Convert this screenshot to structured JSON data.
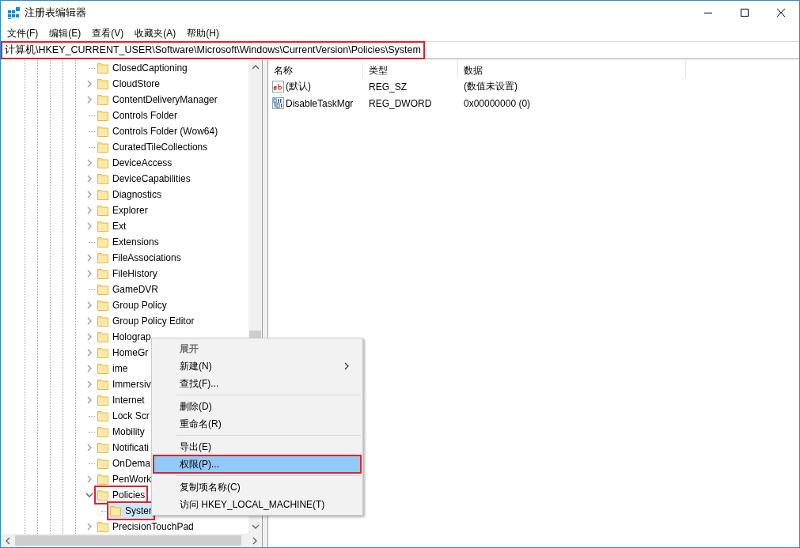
{
  "window": {
    "title": "注册表编辑器"
  },
  "menu": [
    "文件(F)",
    "编辑(E)",
    "查看(V)",
    "收藏夹(A)",
    "帮助(H)"
  ],
  "address_bar": {
    "value": "计算机\\HKEY_CURRENT_USER\\Software\\Microsoft\\Windows\\CurrentVersion\\Policies\\System",
    "highlighted": true
  },
  "tree": [
    {
      "label": "ClosedCaptioning",
      "kind": "leaf",
      "selected": false,
      "highlighted": false
    },
    {
      "label": "CloudStore",
      "kind": "node",
      "expanded": false,
      "selected": false,
      "highlighted": false
    },
    {
      "label": "ContentDeliveryManager",
      "kind": "node",
      "expanded": false,
      "selected": false,
      "highlighted": false
    },
    {
      "label": "Controls Folder",
      "kind": "leaf",
      "selected": false,
      "highlighted": false
    },
    {
      "label": "Controls Folder (Wow64)",
      "kind": "leaf",
      "selected": false,
      "highlighted": false
    },
    {
      "label": "CuratedTileCollections",
      "kind": "leaf",
      "selected": false,
      "highlighted": false
    },
    {
      "label": "DeviceAccess",
      "kind": "node",
      "expanded": false,
      "selected": false,
      "highlighted": false
    },
    {
      "label": "DeviceCapabilities",
      "kind": "node",
      "expanded": false,
      "selected": false,
      "highlighted": false
    },
    {
      "label": "Diagnostics",
      "kind": "node",
      "expanded": false,
      "selected": false,
      "highlighted": false
    },
    {
      "label": "Explorer",
      "kind": "node",
      "expanded": false,
      "selected": false,
      "highlighted": false
    },
    {
      "label": "Ext",
      "kind": "node",
      "expanded": false,
      "selected": false,
      "highlighted": false
    },
    {
      "label": "Extensions",
      "kind": "leaf",
      "selected": false,
      "highlighted": false
    },
    {
      "label": "FileAssociations",
      "kind": "node",
      "expanded": false,
      "selected": false,
      "highlighted": false
    },
    {
      "label": "FileHistory",
      "kind": "node",
      "expanded": false,
      "selected": false,
      "highlighted": false
    },
    {
      "label": "GameDVR",
      "kind": "leaf",
      "selected": false,
      "highlighted": false
    },
    {
      "label": "Group Policy",
      "kind": "node",
      "expanded": false,
      "selected": false,
      "highlighted": false
    },
    {
      "label": "Group Policy Editor",
      "kind": "node",
      "expanded": false,
      "selected": false,
      "highlighted": false
    },
    {
      "label": "Holograp",
      "kind": "node",
      "expanded": false,
      "selected": false,
      "highlighted": false
    },
    {
      "label": "HomeGr",
      "kind": "node",
      "expanded": false,
      "selected": false,
      "highlighted": false
    },
    {
      "label": "ime",
      "kind": "node",
      "expanded": false,
      "selected": false,
      "highlighted": false
    },
    {
      "label": "Immersiv",
      "kind": "node",
      "expanded": false,
      "selected": false,
      "highlighted": false
    },
    {
      "label": "Internet",
      "kind": "node",
      "expanded": false,
      "selected": false,
      "highlighted": false
    },
    {
      "label": "Lock Scr",
      "kind": "leaf",
      "selected": false,
      "highlighted": false
    },
    {
      "label": "Mobility",
      "kind": "leaf",
      "selected": false,
      "highlighted": false
    },
    {
      "label": "Notificati",
      "kind": "node",
      "expanded": false,
      "selected": false,
      "highlighted": false
    },
    {
      "label": "OnDema",
      "kind": "leaf",
      "selected": false,
      "highlighted": false
    },
    {
      "label": "PenWork",
      "kind": "node",
      "expanded": false,
      "selected": false,
      "highlighted": false
    },
    {
      "label": "Policies",
      "kind": "node",
      "expanded": true,
      "selected": false,
      "highlighted": true,
      "children": [
        {
          "label": "Syster",
          "kind": "leaf",
          "selected": true,
          "highlighted": true
        }
      ]
    },
    {
      "label": "PrecisionTouchPad",
      "kind": "node",
      "expanded": false,
      "selected": false,
      "highlighted": false
    }
  ],
  "list": {
    "columns": [
      "名称",
      "类型",
      "数据"
    ],
    "rows": [
      {
        "kind": "string",
        "name": "(默认)",
        "type": "REG_SZ",
        "data": "(数值未设置)"
      },
      {
        "kind": "binary",
        "name": "DisableTaskMgr",
        "type": "REG_DWORD",
        "data": "0x00000000 (0)"
      }
    ]
  },
  "context_menu": {
    "groups": [
      [
        {
          "label": "展开",
          "bold": true,
          "disabled": true,
          "submenu": false,
          "selected": false,
          "highlighted": false
        },
        {
          "label": "新建(N)",
          "bold": false,
          "disabled": false,
          "submenu": true,
          "selected": false,
          "highlighted": false
        },
        {
          "label": "查找(F)...",
          "bold": false,
          "disabled": false,
          "submenu": false,
          "selected": false,
          "highlighted": false
        }
      ],
      [
        {
          "label": "删除(D)",
          "bold": false,
          "disabled": false,
          "submenu": false,
          "selected": false,
          "highlighted": false
        },
        {
          "label": "重命名(R)",
          "bold": false,
          "disabled": false,
          "submenu": false,
          "selected": false,
          "highlighted": false
        }
      ],
      [
        {
          "label": "导出(E)",
          "bold": false,
          "disabled": false,
          "submenu": false,
          "selected": false,
          "highlighted": false
        },
        {
          "label": "权限(P)...",
          "bold": false,
          "disabled": false,
          "submenu": false,
          "selected": true,
          "highlighted": true
        }
      ],
      [
        {
          "label": "复制项名称(C)",
          "bold": false,
          "disabled": false,
          "submenu": false,
          "selected": false,
          "highlighted": false
        },
        {
          "label": "访问 HKEY_LOCAL_MACHINE(T)",
          "bold": false,
          "disabled": false,
          "submenu": false,
          "selected": false,
          "highlighted": false
        }
      ]
    ]
  }
}
